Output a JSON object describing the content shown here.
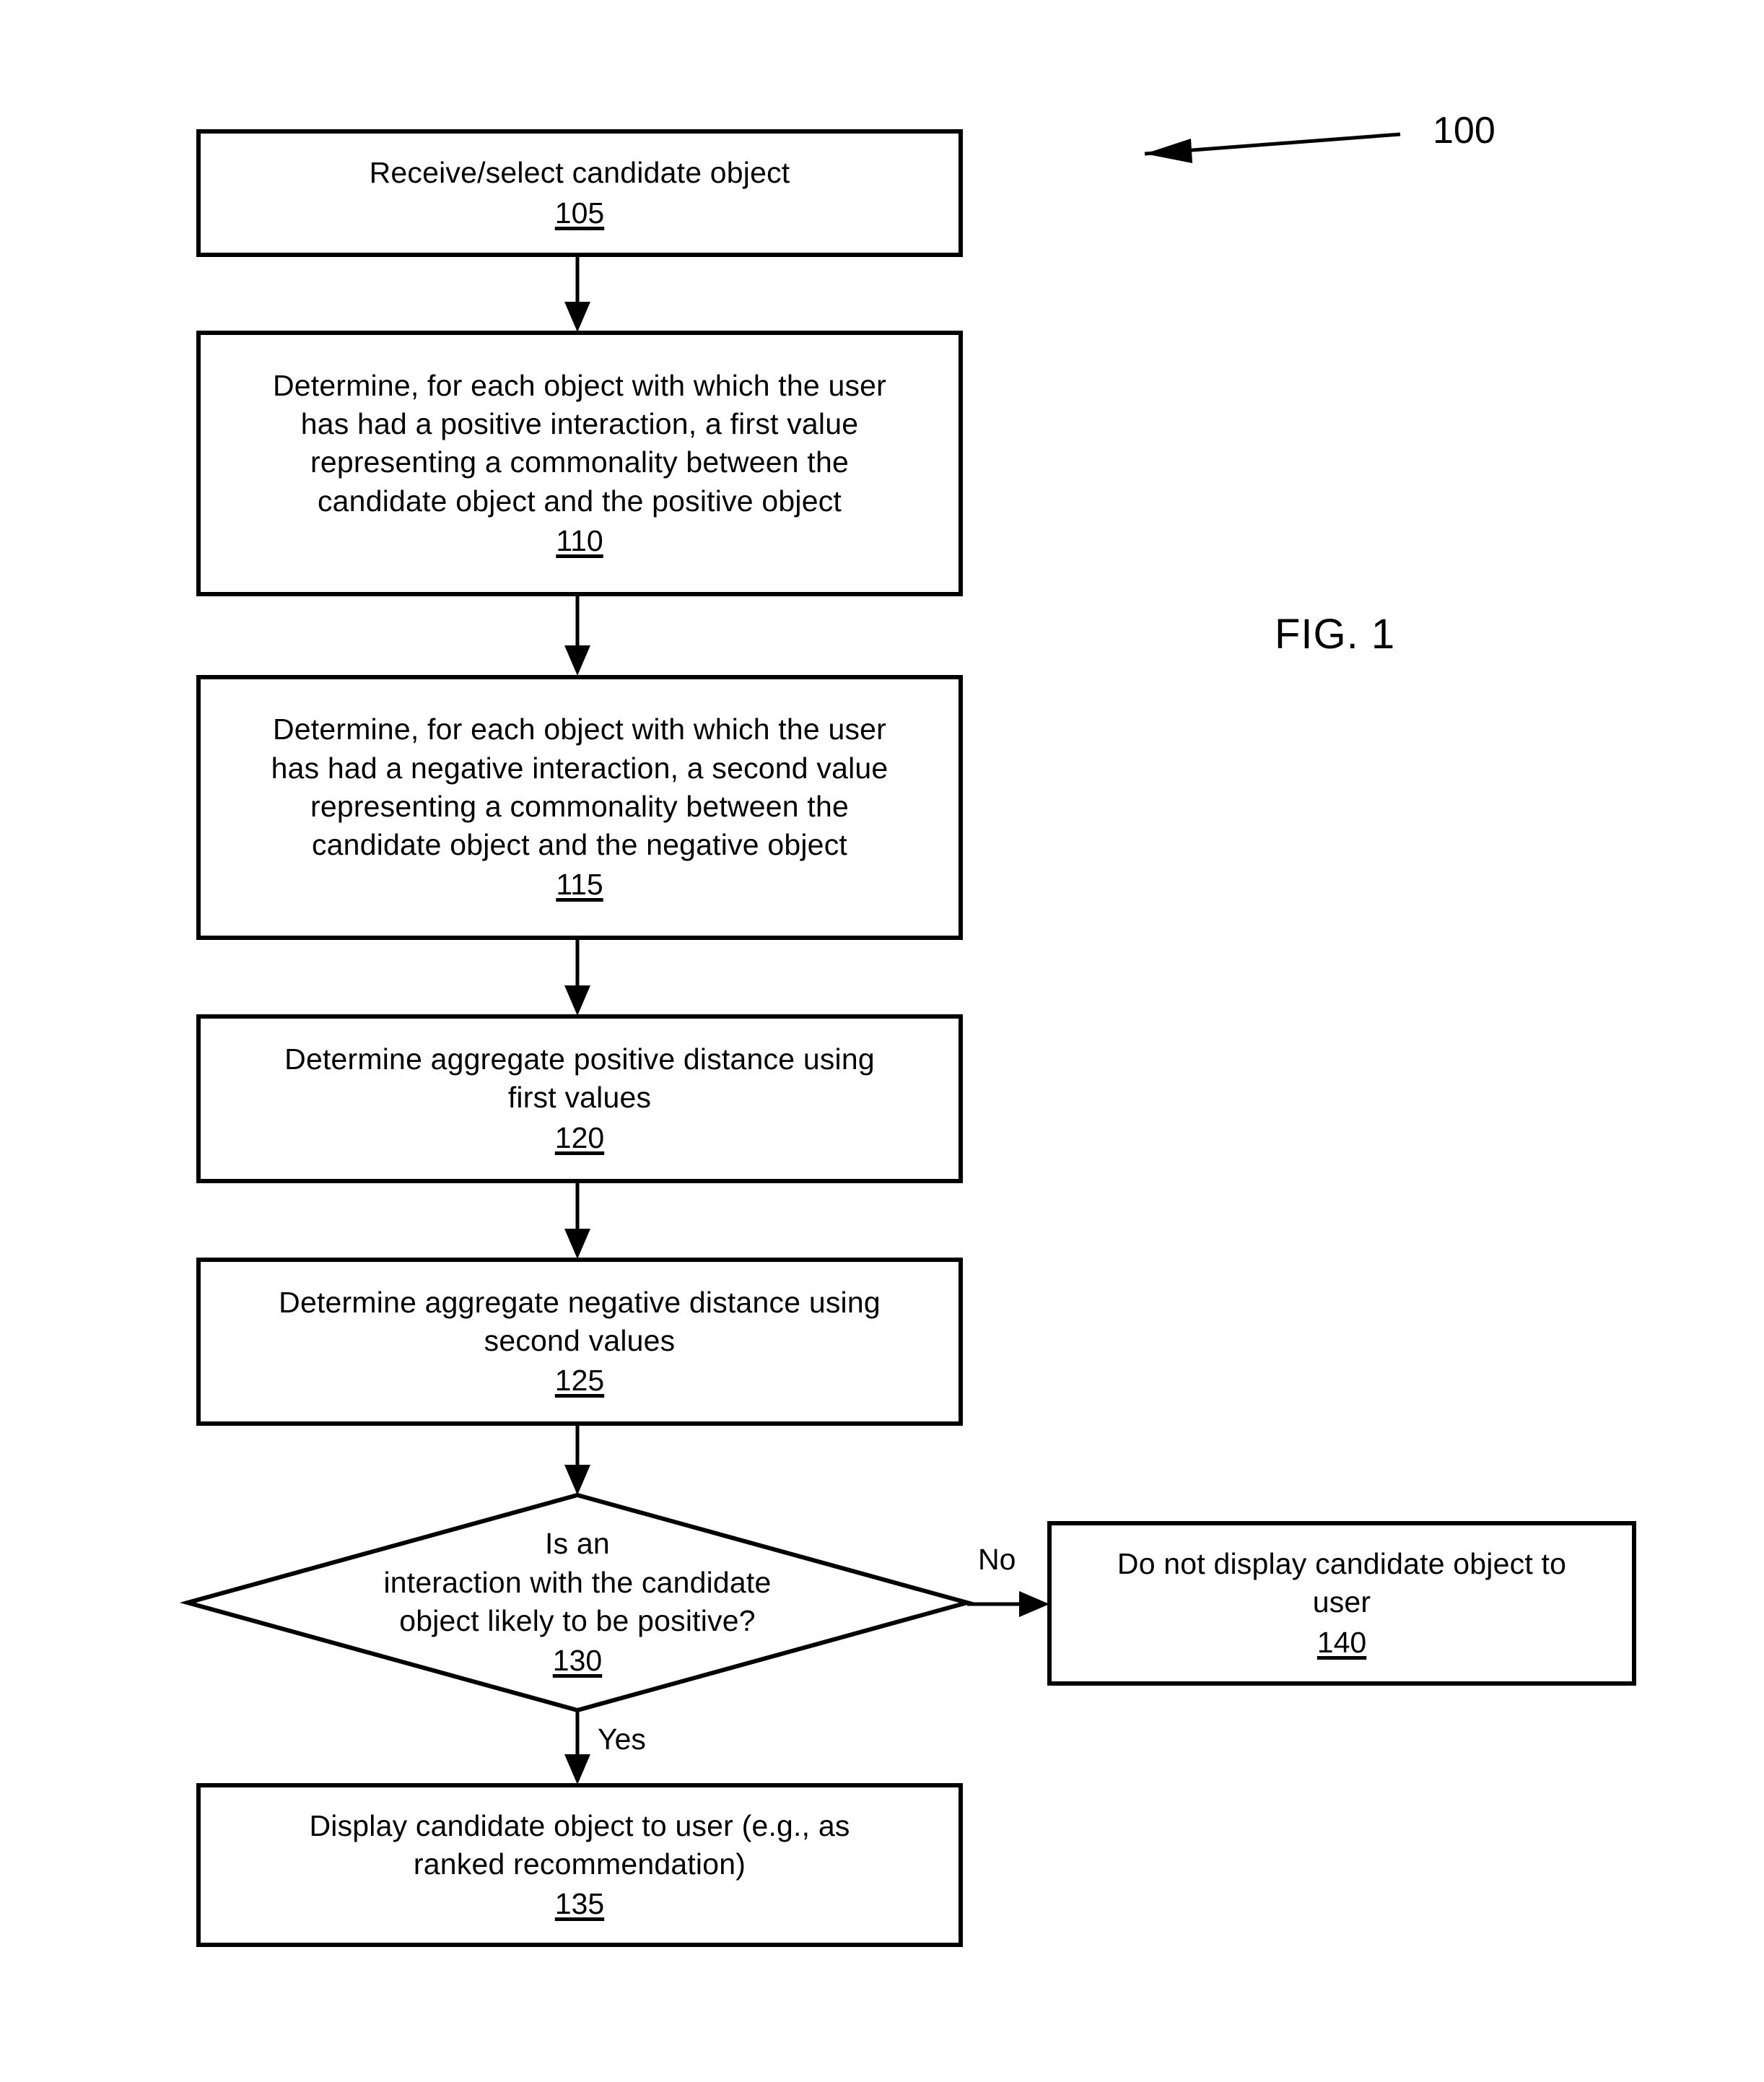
{
  "figure": {
    "label": "FIG. 1",
    "reference_numeral": "100"
  },
  "flowchart": {
    "nodes": [
      {
        "id": "n105",
        "shape": "process",
        "text": "Receive/select candidate object",
        "ref": "105"
      },
      {
        "id": "n110",
        "shape": "process",
        "text": "Determine, for each object with which the user\nhas had a positive interaction, a first value\nrepresenting a commonality between the\ncandidate object and the positive object",
        "ref": "110"
      },
      {
        "id": "n115",
        "shape": "process",
        "text": "Determine, for each object with which the user\nhas had a negative interaction, a second value\nrepresenting a commonality between the\ncandidate object and the negative object",
        "ref": "115"
      },
      {
        "id": "n120",
        "shape": "process",
        "text": "Determine aggregate positive distance using\nfirst values",
        "ref": "120"
      },
      {
        "id": "n125",
        "shape": "process",
        "text": "Determine aggregate negative distance using\nsecond values",
        "ref": "125"
      },
      {
        "id": "n130",
        "shape": "decision",
        "text": "Is an\ninteraction with the candidate\nobject likely to be positive?",
        "ref": "130"
      },
      {
        "id": "n135",
        "shape": "process",
        "text": "Display candidate object to user (e.g., as\nranked recommendation)",
        "ref": "135"
      },
      {
        "id": "n140",
        "shape": "process",
        "text": "Do not display candidate object to\nuser",
        "ref": "140"
      }
    ],
    "edge_labels": {
      "no": "No",
      "yes": "Yes"
    }
  },
  "style": {
    "stroke": "#000000",
    "background": "#ffffff"
  }
}
